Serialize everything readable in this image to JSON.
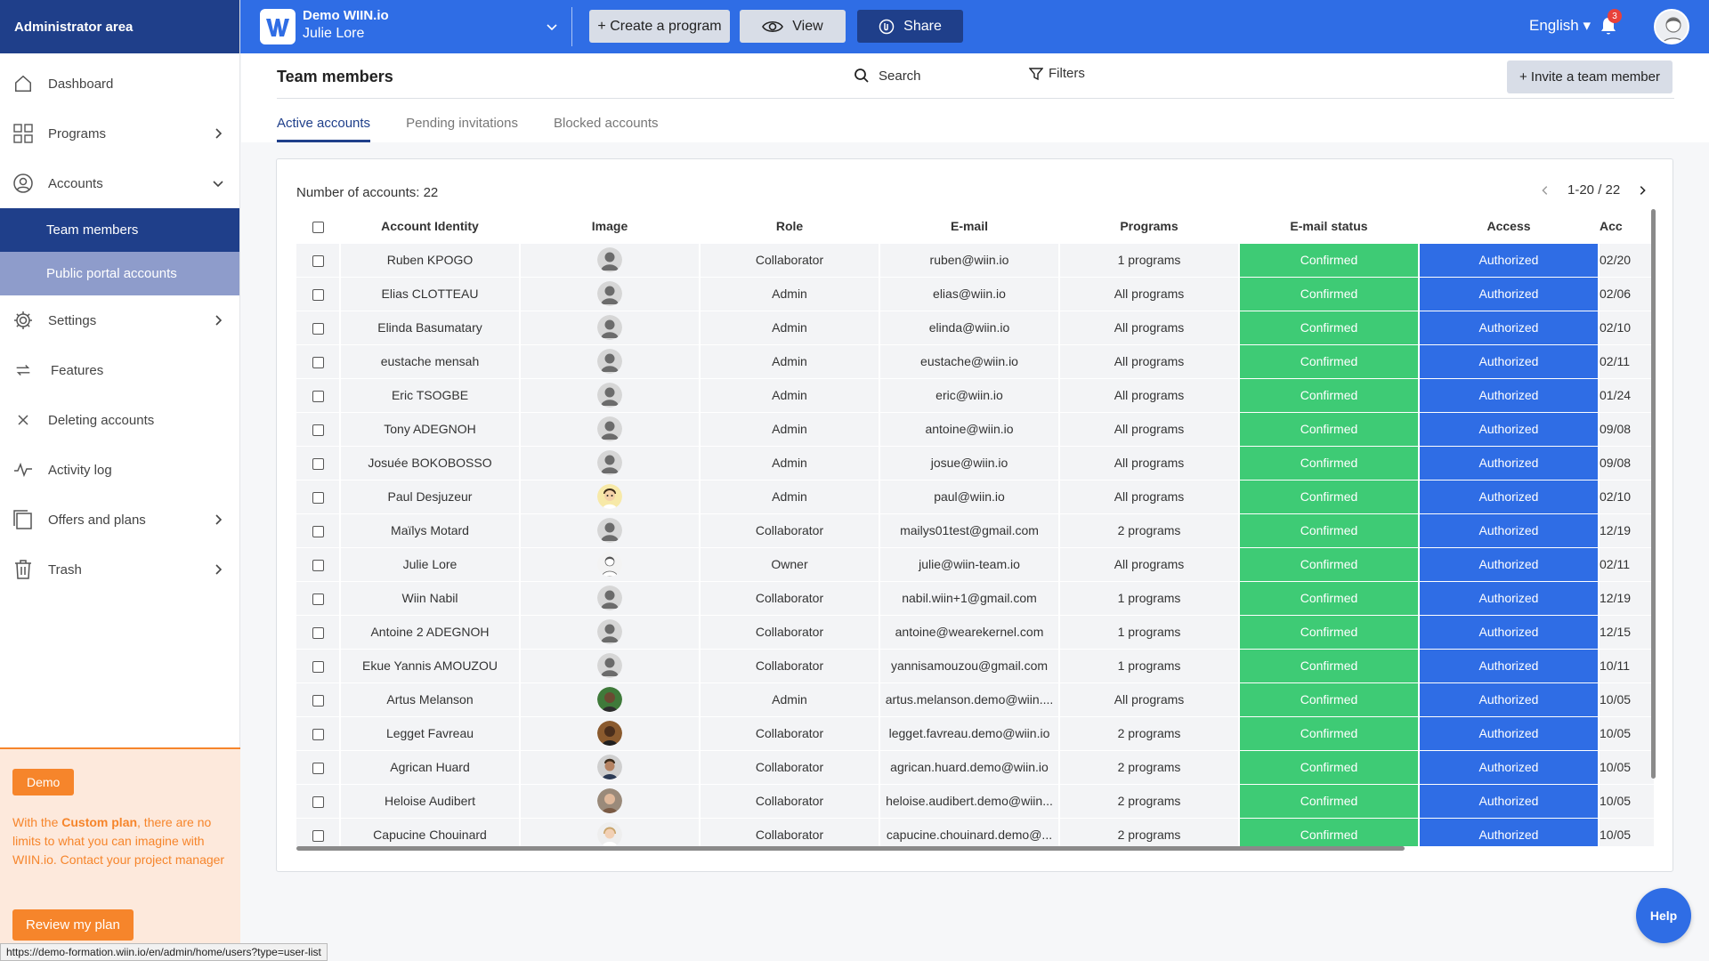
{
  "sidebar": {
    "title": "Administrator area",
    "items": [
      {
        "label": "Dashboard",
        "icon": "home-icon"
      },
      {
        "label": "Programs",
        "icon": "grid-icon"
      },
      {
        "label": "Accounts",
        "icon": "user-circle-icon"
      },
      {
        "label": "Settings",
        "icon": "gear-icon"
      },
      {
        "label": "Features",
        "icon": "arrows-icon"
      },
      {
        "label": "Deleting accounts",
        "icon": "close-icon"
      },
      {
        "label": "Activity log",
        "icon": "activity-icon"
      },
      {
        "label": "Offers and plans",
        "icon": "copy-icon"
      },
      {
        "label": "Trash",
        "icon": "trash-icon"
      }
    ],
    "sub_items": [
      {
        "label": "Team members"
      },
      {
        "label": "Public portal accounts"
      }
    ],
    "promo": {
      "badge": "Demo",
      "text_before": "With the ",
      "text_bold": "Custom plan",
      "text_after": ", there are no limits to what you can imagine with WIIN.io. Contact your project manager",
      "button": "Review my plan"
    },
    "status_url": "https://demo-formation.wiin.io/en/admin/home/users?type=user-list"
  },
  "topbar": {
    "org_name": "Demo WIIN.io",
    "user_name": "Julie Lore",
    "create_label": "+ Create a program",
    "view_label": "View",
    "share_label": "Share",
    "language": "English",
    "notification_count": "3",
    "brand_color": "#2f6de5",
    "dark_color": "#1f3f8a"
  },
  "page": {
    "title": "Team members",
    "search_label": "Search",
    "filters_label": "Filters",
    "invite_label": "+ Invite a team member",
    "tabs": [
      "Active accounts",
      "Pending invitations",
      "Blocked accounts"
    ]
  },
  "table": {
    "count_label": "Number of accounts: 22",
    "pager": "1-20 / 22",
    "headers": [
      "Account Identity",
      "Image",
      "Role",
      "E-mail",
      "Programs",
      "E-mail status",
      "Access",
      "Acc"
    ],
    "status_color": "#3ecb75",
    "access_color": "#2f6de5",
    "rows": [
      {
        "name": "Ruben KPOGO",
        "avatar": "default",
        "role": "Collaborator",
        "email": "ruben@wiin.io",
        "programs": "1 programs",
        "status": "Confirmed",
        "access": "Authorized",
        "date": "02/20"
      },
      {
        "name": "Elias CLOTTEAU",
        "avatar": "default",
        "role": "Admin",
        "email": "elias@wiin.io",
        "programs": "All programs",
        "status": "Confirmed",
        "access": "Authorized",
        "date": "02/06"
      },
      {
        "name": "Elinda Basumatary",
        "avatar": "default",
        "role": "Admin",
        "email": "elinda@wiin.io",
        "programs": "All programs",
        "status": "Confirmed",
        "access": "Authorized",
        "date": "02/10"
      },
      {
        "name": "eustache mensah",
        "avatar": "default",
        "role": "Admin",
        "email": "eustache@wiin.io",
        "programs": "All programs",
        "status": "Confirmed",
        "access": "Authorized",
        "date": "02/11"
      },
      {
        "name": "Eric TSOGBE",
        "avatar": "default",
        "role": "Admin",
        "email": "eric@wiin.io",
        "programs": "All programs",
        "status": "Confirmed",
        "access": "Authorized",
        "date": "01/24"
      },
      {
        "name": "Tony ADEGNOH",
        "avatar": "default",
        "role": "Admin",
        "email": "antoine@wiin.io",
        "programs": "All programs",
        "status": "Confirmed",
        "access": "Authorized",
        "date": "09/08"
      },
      {
        "name": "Josuée BOKOBOSSO",
        "avatar": "default",
        "role": "Admin",
        "email": "josue@wiin.io",
        "programs": "All programs",
        "status": "Confirmed",
        "access": "Authorized",
        "date": "09/08"
      },
      {
        "name": "Paul Desjuzeur",
        "avatar": "cartoon",
        "role": "Admin",
        "email": "paul@wiin.io",
        "programs": "All programs",
        "status": "Confirmed",
        "access": "Authorized",
        "date": "02/10"
      },
      {
        "name": "Maïlys Motard",
        "avatar": "default",
        "role": "Collaborator",
        "email": "mailys01test@gmail.com",
        "programs": "2 programs",
        "status": "Confirmed",
        "access": "Authorized",
        "date": "12/19"
      },
      {
        "name": "Julie Lore",
        "avatar": "sketch",
        "role": "Owner",
        "email": "julie@wiin-team.io",
        "programs": "All programs",
        "status": "Confirmed",
        "access": "Authorized",
        "date": "02/11"
      },
      {
        "name": "Wiin Nabil",
        "avatar": "default",
        "role": "Collaborator",
        "email": "nabil.wiin+1@gmail.com",
        "programs": "1 programs",
        "status": "Confirmed",
        "access": "Authorized",
        "date": "12/19"
      },
      {
        "name": "Antoine 2 ADEGNOH",
        "avatar": "default",
        "role": "Collaborator",
        "email": "antoine@wearekernel.com",
        "programs": "1 programs",
        "status": "Confirmed",
        "access": "Authorized",
        "date": "12/15"
      },
      {
        "name": "Ekue Yannis AMOUZOU",
        "avatar": "default",
        "role": "Collaborator",
        "email": "yannisamouzou@gmail.com",
        "programs": "1 programs",
        "status": "Confirmed",
        "access": "Authorized",
        "date": "10/11"
      },
      {
        "name": "Artus Melanson",
        "avatar": "photo-green",
        "role": "Admin",
        "email": "artus.melanson.demo@wiin....",
        "programs": "All programs",
        "status": "Confirmed",
        "access": "Authorized",
        "date": "10/05"
      },
      {
        "name": "Legget Favreau",
        "avatar": "photo-dark",
        "role": "Collaborator",
        "email": "legget.favreau.demo@wiin.io",
        "programs": "2 programs",
        "status": "Confirmed",
        "access": "Authorized",
        "date": "10/05"
      },
      {
        "name": "Agrican Huard",
        "avatar": "photo-brown",
        "role": "Collaborator",
        "email": "agrican.huard.demo@wiin.io",
        "programs": "2 programs",
        "status": "Confirmed",
        "access": "Authorized",
        "date": "10/05"
      },
      {
        "name": "Heloise Audibert",
        "avatar": "photo-tan",
        "role": "Collaborator",
        "email": "heloise.audibert.demo@wiin...",
        "programs": "2 programs",
        "status": "Confirmed",
        "access": "Authorized",
        "date": "10/05"
      },
      {
        "name": "Capucine Chouinard",
        "avatar": "photo-light",
        "role": "Collaborator",
        "email": "capucine.chouinard.demo@...",
        "programs": "2 programs",
        "status": "Confirmed",
        "access": "Authorized",
        "date": "10/05"
      }
    ]
  },
  "help_label": "Help"
}
